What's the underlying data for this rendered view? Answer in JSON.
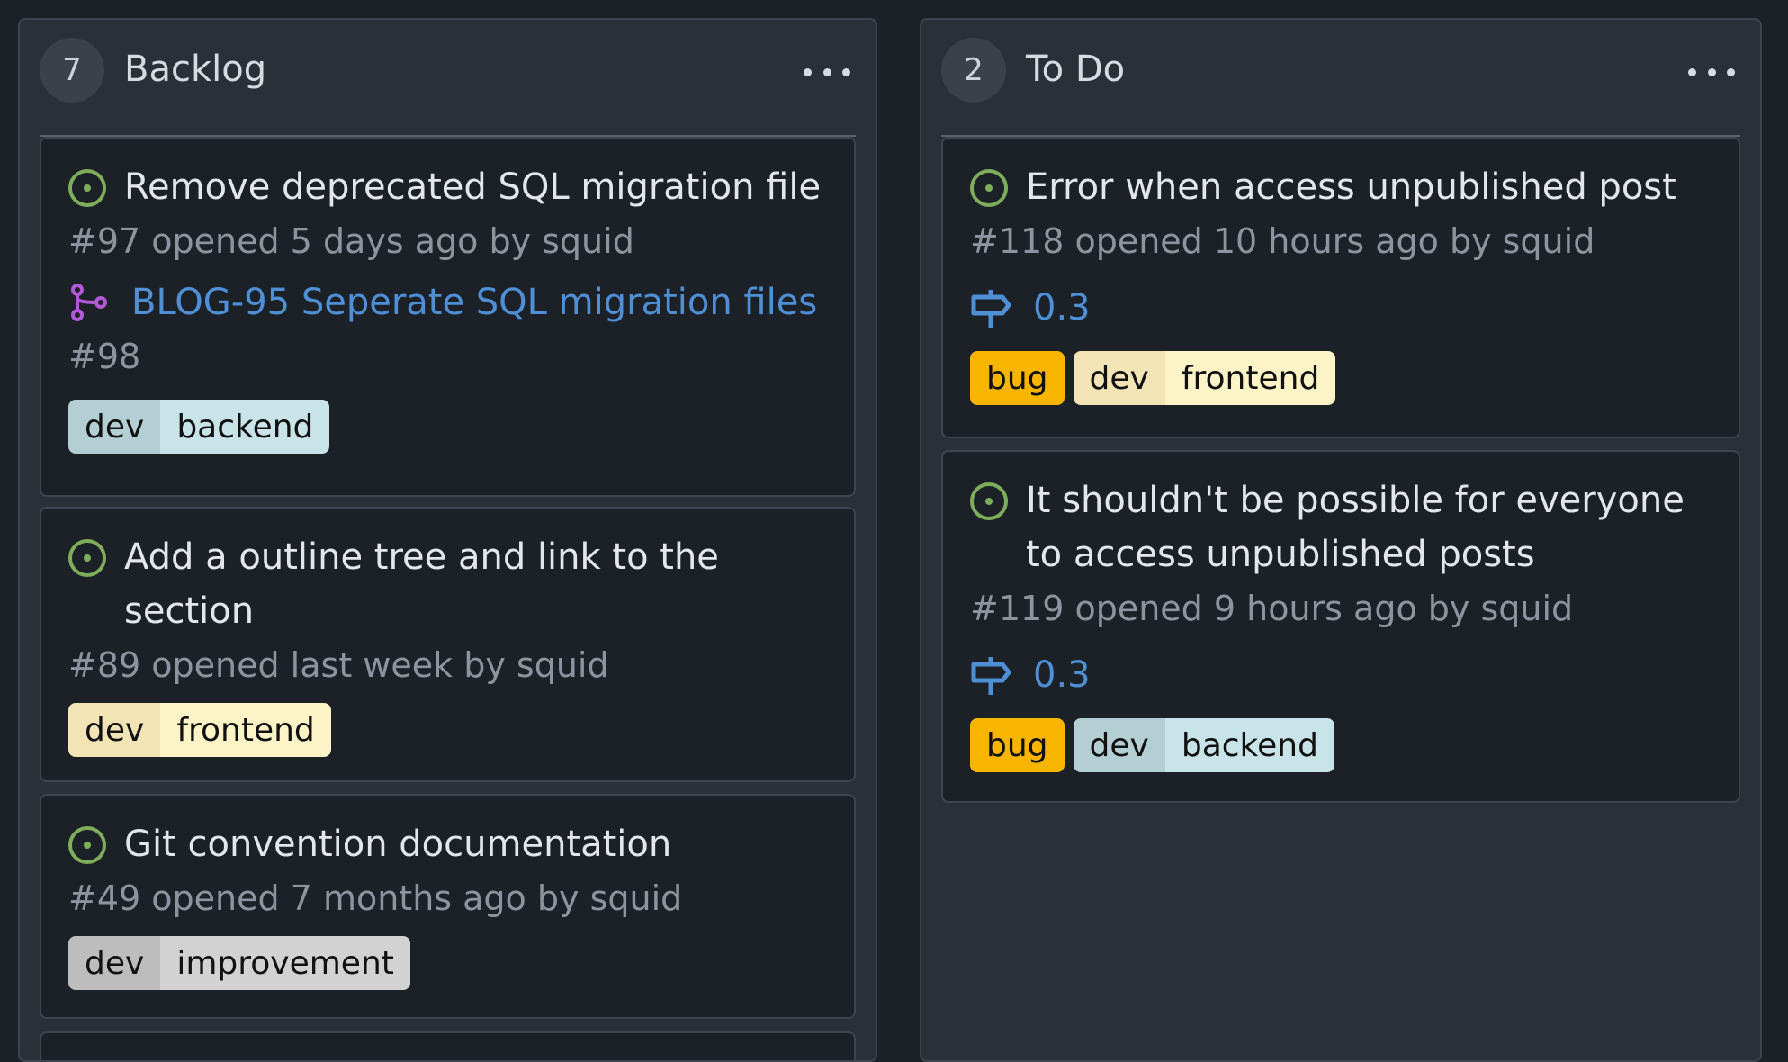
{
  "columns": [
    {
      "count": "7",
      "title": "Backlog",
      "cards": [
        {
          "title": "Remove deprecated SQL migration file",
          "meta": "#97 opened 5 days ago by squid",
          "linked_title": "BLOG-95 Seperate SQL migration files",
          "linked_number": "#98",
          "labels": [
            {
              "scope": "dev",
              "name": "backend",
              "scope_color": "#b4cfd4",
              "name_color": "#c9e4e8"
            }
          ]
        },
        {
          "title": "Add a outline tree and link to the section",
          "meta": "#89 opened last week by squid",
          "labels": [
            {
              "scope": "dev",
              "name": "frontend",
              "scope_color": "#f2e4b5",
              "name_color": "#fcf3c6"
            }
          ]
        },
        {
          "title": "Git convention documentation",
          "meta": "#49 opened 7 months ago by squid",
          "labels": [
            {
              "scope": "dev",
              "name": "improvement",
              "scope_color": "#bdbdbd",
              "name_color": "#d2d2d2"
            }
          ]
        }
      ]
    },
    {
      "count": "2",
      "title": "To Do",
      "cards": [
        {
          "title": "Error when access unpublished post",
          "meta": "#118 opened 10 hours ago by squid",
          "milestone": "0.3",
          "labels": [
            {
              "name": "bug",
              "color": "#f7b500"
            },
            {
              "scope": "dev",
              "name": "frontend",
              "scope_color": "#f2e4b5",
              "name_color": "#fcf3c6"
            }
          ]
        },
        {
          "title": "It shouldn't be possible for everyone to access unpublished posts",
          "meta": "#119 opened 9 hours ago by squid",
          "milestone": "0.3",
          "labels": [
            {
              "name": "bug",
              "color": "#f7b500"
            },
            {
              "scope": "dev",
              "name": "backend",
              "scope_color": "#b4cfd4",
              "name_color": "#c9e4e8"
            }
          ]
        }
      ]
    }
  ],
  "icons": {
    "column_menu": "more-horizontal-icon",
    "issue": "issue-open-icon",
    "linked_pr": "git-branch-icon",
    "milestone": "milestone-signpost-icon"
  },
  "colors": {
    "issue_open": "#7fae5a",
    "link": "#4f8fd6",
    "branch": "#b25ad6"
  }
}
